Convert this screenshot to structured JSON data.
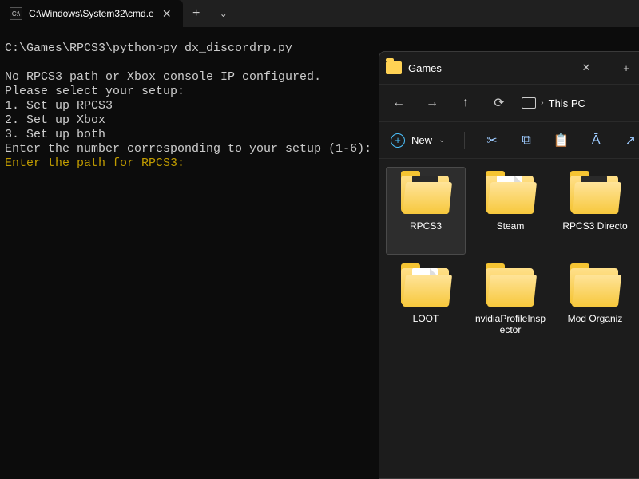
{
  "terminal": {
    "tab_title": "C:\\Windows\\System32\\cmd.e",
    "icon_label": "C:\\",
    "lines": [
      "C:\\Games\\RPCS3\\python>py dx_discordrp.py",
      "",
      "No RPCS3 path or Xbox console IP configured.",
      "Please select your setup:",
      "1. Set up RPCS3",
      "2. Set up Xbox",
      "3. Set up both",
      "Enter the number corresponding to your setup (1-6):"
    ],
    "prompt_line": "Enter the path for RPCS3:"
  },
  "explorer": {
    "title": "Games",
    "breadcrumb": "This PC",
    "new_label": "New",
    "items": [
      {
        "label": "RPCS3",
        "variant": "accent",
        "selected": true
      },
      {
        "label": "Steam",
        "variant": "doc",
        "selected": false
      },
      {
        "label": "RPCS3 Directo",
        "variant": "accent",
        "selected": false
      },
      {
        "label": "LOOT",
        "variant": "doc",
        "selected": false
      },
      {
        "label": "nvidiaProfileInspector",
        "variant": "plain",
        "selected": false
      },
      {
        "label": "Mod Organiz",
        "variant": "plain",
        "selected": false
      }
    ]
  }
}
